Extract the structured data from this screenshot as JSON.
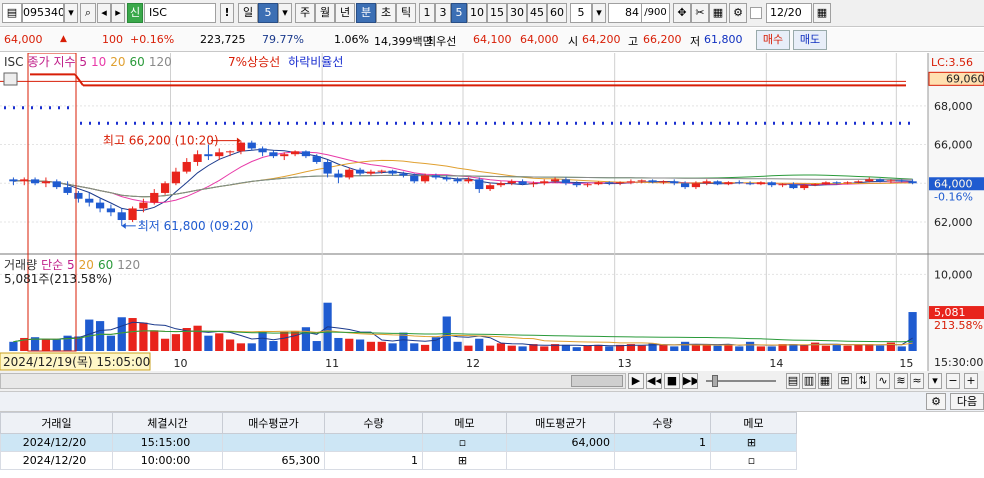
{
  "toolbar": {
    "code": "095340",
    "badge": "신",
    "name": "ISC",
    "excl": "!",
    "period_day": "일",
    "period_num": "5",
    "week": "주",
    "month": "월",
    "year": "년",
    "minute": "분",
    "sec": "초",
    "tick": "틱",
    "intervals": [
      "1",
      "3",
      "5",
      "10",
      "15",
      "30",
      "45",
      "60"
    ],
    "selected_interval": "5",
    "count_value": "5",
    "bars_shown": "84",
    "bars_total": "/900",
    "date_value": "12/20"
  },
  "quote": {
    "price": "64,000",
    "change": "100",
    "change_pct": "+0.16%",
    "volume": "223,725",
    "vol_ratio": "79.77%",
    "turnover": "1.06%",
    "amount": "14,399백만",
    "best_label": "최우선",
    "best_ask": "64,100",
    "best_bid": "64,000",
    "open_label": "시",
    "open": "64,200",
    "high_label": "고",
    "high": "66,200",
    "low_label": "저",
    "low": "61,800",
    "buy_label": "매수",
    "sell_label": "매도"
  },
  "chart_data": {
    "type": "candlestick",
    "title": "ISC",
    "legend_price": [
      "ISC",
      "종가 지수 5",
      "10",
      "20",
      "60",
      "120"
    ],
    "legend_extra": [
      "7%상승선",
      "하락비율선"
    ],
    "lc_label": "LC:3.56",
    "price_label": "64,000",
    "price_pct": "-0.16%",
    "upper_line_label": "69,060",
    "y_ticks": [
      "68,000",
      "66,000",
      "64,000",
      "62,000"
    ],
    "ylim": [
      60500,
      69800
    ],
    "upper_line": 69060,
    "dot_line_left": 67900,
    "dot_line_right": 67100,
    "high_note": "최고 66,200 (10:20)",
    "low_note": "최저 61,800 (09:20)",
    "volume_legend": [
      "거래량",
      "단순 5",
      "20",
      "60",
      "120"
    ],
    "volume_current": "5,081주(213.58%)",
    "volume_tick": "10,000",
    "volume_value": "5,081",
    "volume_pct": "213.58%",
    "x_labels": [
      "10",
      "11",
      "12",
      "13",
      "14",
      "15"
    ],
    "cursor_label": "2024/12/19(목) 15:05:00",
    "time_label": "15:30:00",
    "candles": [
      [
        64200,
        64300,
        63900,
        64100
      ],
      [
        64100,
        64300,
        63900,
        64200
      ],
      [
        64200,
        64300,
        63900,
        64000
      ],
      [
        64000,
        64300,
        63800,
        64100
      ],
      [
        64100,
        64200,
        63700,
        63800
      ],
      [
        63800,
        64100,
        63400,
        63500
      ],
      [
        63500,
        63600,
        63000,
        63200
      ],
      [
        63200,
        63500,
        62800,
        63000
      ],
      [
        63000,
        63200,
        62500,
        62700
      ],
      [
        62700,
        62900,
        62300,
        62500
      ],
      [
        62500,
        62700,
        61800,
        62100
      ],
      [
        62100,
        62800,
        62000,
        62700
      ],
      [
        62700,
        63200,
        62500,
        63000
      ],
      [
        63000,
        63700,
        62900,
        63500
      ],
      [
        63500,
        64100,
        63400,
        64000
      ],
      [
        64000,
        64800,
        63900,
        64600
      ],
      [
        64600,
        65300,
        64500,
        65100
      ],
      [
        65100,
        65700,
        64900,
        65500
      ],
      [
        65500,
        66000,
        65200,
        65400
      ],
      [
        65400,
        65800,
        65200,
        65600
      ],
      [
        65600,
        65700,
        65400,
        65650
      ],
      [
        65650,
        66200,
        65500,
        66100
      ],
      [
        66100,
        66200,
        65700,
        65800
      ],
      [
        65800,
        65900,
        65400,
        65600
      ],
      [
        65600,
        65700,
        65300,
        65400
      ],
      [
        65400,
        65600,
        65200,
        65500
      ],
      [
        65500,
        65700,
        65400,
        65650
      ],
      [
        65650,
        65700,
        65300,
        65400
      ],
      [
        65400,
        65500,
        65000,
        65100
      ],
      [
        65100,
        65200,
        64300,
        64500
      ],
      [
        64500,
        64700,
        64000,
        64300
      ],
      [
        64300,
        64800,
        64200,
        64700
      ],
      [
        64700,
        64800,
        64400,
        64500
      ],
      [
        64500,
        64700,
        64400,
        64600
      ],
      [
        64600,
        64700,
        64500,
        64650
      ],
      [
        64650,
        64700,
        64400,
        64500
      ],
      [
        64500,
        64600,
        64300,
        64400
      ],
      [
        64400,
        64500,
        64000,
        64100
      ],
      [
        64100,
        64500,
        64000,
        64400
      ],
      [
        64400,
        64500,
        64200,
        64300
      ],
      [
        64300,
        64400,
        64100,
        64200
      ],
      [
        64200,
        64300,
        64000,
        64100
      ],
      [
        64100,
        64300,
        64000,
        64200
      ],
      [
        64200,
        64300,
        63500,
        63700
      ],
      [
        63700,
        64000,
        63600,
        63900
      ],
      [
        63900,
        64100,
        63800,
        64000
      ],
      [
        64000,
        64200,
        63900,
        64100
      ],
      [
        64100,
        64200,
        63900,
        63950
      ],
      [
        63950,
        64100,
        63800,
        64000
      ],
      [
        64000,
        64200,
        63900,
        64100
      ],
      [
        64100,
        64300,
        64000,
        64200
      ],
      [
        64200,
        64300,
        63900,
        64000
      ],
      [
        64000,
        64100,
        63800,
        63900
      ],
      [
        63900,
        64000,
        63800,
        63950
      ],
      [
        63950,
        64100,
        63900,
        64050
      ],
      [
        64050,
        64100,
        63900,
        64000
      ],
      [
        64000,
        64100,
        63900,
        64050
      ],
      [
        64050,
        64200,
        63950,
        64100
      ],
      [
        64100,
        64200,
        64000,
        64150
      ],
      [
        64150,
        64200,
        64000,
        64050
      ],
      [
        64050,
        64150,
        63950,
        64100
      ],
      [
        64100,
        64200,
        63900,
        64000
      ],
      [
        64000,
        64100,
        63700,
        63800
      ],
      [
        63800,
        64100,
        63700,
        64000
      ],
      [
        64000,
        64200,
        63900,
        64100
      ],
      [
        64100,
        64150,
        63900,
        63950
      ],
      [
        63950,
        64100,
        63900,
        64050
      ],
      [
        64050,
        64150,
        63950,
        64000
      ],
      [
        64000,
        64100,
        63900,
        63950
      ],
      [
        63950,
        64100,
        63900,
        64050
      ],
      [
        64050,
        64100,
        63800,
        63900
      ],
      [
        63900,
        64000,
        63800,
        63950
      ],
      [
        63950,
        64050,
        63700,
        63750
      ],
      [
        63750,
        63950,
        63650,
        63900
      ],
      [
        63900,
        64000,
        63850,
        63950
      ],
      [
        63950,
        64100,
        63900,
        64050
      ],
      [
        64050,
        64100,
        63950,
        64000
      ],
      [
        64000,
        64100,
        63950,
        64050
      ],
      [
        64050,
        64150,
        64000,
        64100
      ],
      [
        64100,
        64300,
        64050,
        64200
      ],
      [
        64200,
        64250,
        64050,
        64100
      ],
      [
        64100,
        64200,
        64000,
        64150
      ],
      [
        64150,
        64200,
        64050,
        64100
      ],
      [
        64100,
        64200,
        63950,
        64000
      ]
    ],
    "volumes": [
      1200,
      1700,
      1800,
      1500,
      1500,
      2000,
      1900,
      4100,
      3900,
      2000,
      4400,
      4300,
      3700,
      2700,
      1600,
      2200,
      3000,
      3300,
      2000,
      2300,
      1500,
      1000,
      1000,
      2600,
      1300,
      2500,
      2600,
      3100,
      1300,
      6300,
      1700,
      1600,
      1500,
      1200,
      1200,
      1000,
      2400,
      1000,
      800,
      1800,
      4500,
      1200,
      700,
      1600,
      700,
      1000,
      700,
      600,
      900,
      600,
      900,
      800,
      500,
      700,
      800,
      600,
      800,
      900,
      700,
      1000,
      800,
      600,
      1200,
      800,
      900,
      700,
      800,
      600,
      1200,
      600,
      600,
      900,
      900,
      800,
      1100,
      700,
      900,
      700,
      800,
      900,
      700,
      1100,
      600,
      5081
    ]
  },
  "table": {
    "headers": [
      "거래일",
      "체결시간",
      "매수평균가",
      "수량",
      "메모",
      "매도평균가",
      "수량",
      "메모"
    ],
    "rows": [
      [
        "2024/12/20",
        "15:15:00",
        "",
        "",
        "",
        "64,000",
        "1",
        ""
      ],
      [
        "2024/12/20",
        "10:00:00",
        "65,300",
        "1",
        "",
        "",
        "",
        ""
      ]
    ],
    "next_label": "다음"
  },
  "colors": {
    "up": "#e8241c",
    "down": "#1f5bd0",
    "ma5": "#1b3a8c",
    "ma10": "#e83aa8",
    "ma20": "#e0a030",
    "ma60": "#2a9a3a",
    "ma120": "#8a8a8a"
  }
}
